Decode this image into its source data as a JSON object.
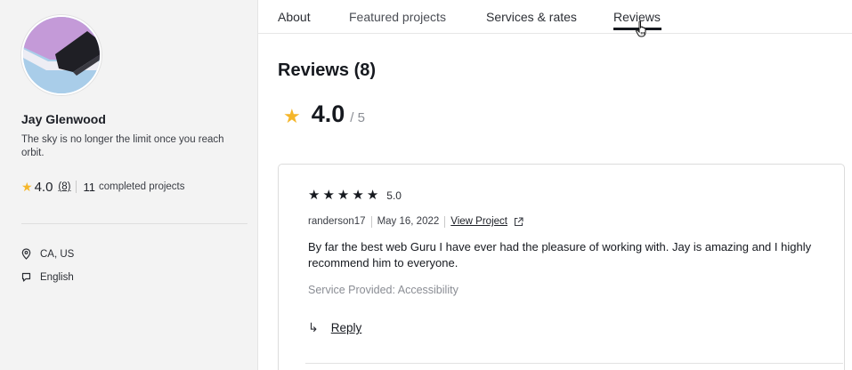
{
  "profile": {
    "name": "Jay Glenwood",
    "tagline": "The sky is no longer the limit once you reach orbit.",
    "rating": "4.0",
    "review_count": "(8)",
    "completed_count": "11",
    "completed_label": "completed projects",
    "location": "CA, US",
    "language": "English"
  },
  "tabs": [
    {
      "label": "About"
    },
    {
      "label": "Featured projects"
    },
    {
      "label": "Services & rates"
    },
    {
      "label": "Reviews",
      "active": true
    }
  ],
  "reviews": {
    "title": "Reviews (8)",
    "average": "4.0",
    "out_of": "/ 5",
    "items": [
      {
        "stars": 5,
        "score": "5.0",
        "author": "randerson17",
        "date": "May 16, 2022",
        "link_label": "View Project",
        "text": "By far the best web Guru I have ever had the pleasure of working with. Jay is amazing and I highly recommend him to everyone.",
        "service": "Service Provided: Accessibility",
        "reply_label": "Reply"
      }
    ]
  },
  "colors": {
    "star_gold": "#f5b62a",
    "sidebar_bg": "#f3f3f3",
    "text_primary": "#16191f",
    "text_muted": "#8a8d94"
  },
  "icons": {
    "rating": "star-icon",
    "location": "location-pin-icon",
    "language": "chat-bubble-icon",
    "external": "external-link-icon",
    "reply": "reply-arrow-icon",
    "cursor": "hand-pointer-icon"
  }
}
